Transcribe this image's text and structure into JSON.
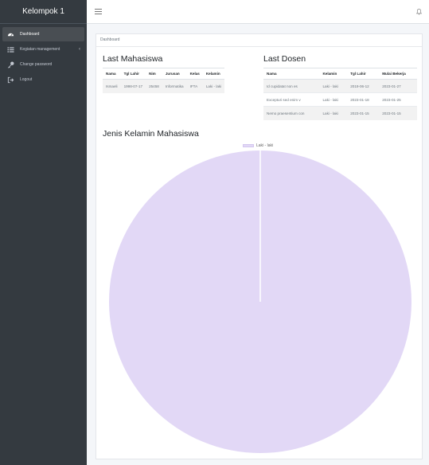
{
  "sidebar": {
    "brand": "Kelompok 1",
    "items": [
      {
        "label": "Dashboard",
        "icon": "dashboard-icon",
        "active": true
      },
      {
        "label": "Kegiatan management",
        "icon": "list-icon",
        "has_submenu": true
      },
      {
        "label": "Change password",
        "icon": "key-icon"
      },
      {
        "label": "Logout",
        "icon": "sign-out-icon"
      }
    ]
  },
  "breadcrumb": "Dashboard",
  "mahasiswa": {
    "title": "Last Mahasiswa",
    "headers": [
      "Nama",
      "Tgl Lahir",
      "Nim",
      "Jurusan",
      "Kelas",
      "Kelamin"
    ],
    "rows": [
      [
        "Ismaeli",
        "1998-07-17",
        "25458",
        "Informatika",
        "IFTA",
        "Laki - laki"
      ]
    ]
  },
  "dosen": {
    "title": "Last Dosen",
    "headers": [
      "Nama",
      "Kelamin",
      "Tgl Lahir",
      "Mulai Bekerja"
    ],
    "rows": [
      [
        "Id cupidatat non es",
        "Laki - laki",
        "2019-06-12",
        "2023-01-27"
      ],
      [
        "Excepturi sed enim v",
        "Laki - laki",
        "2023-01-18",
        "2023-01-25"
      ],
      [
        "Nemo praesentium con",
        "Laki - laki",
        "2023-01-15",
        "2023-01-15"
      ]
    ]
  },
  "chart": {
    "title": "Jenis Kelamin Mahasiswa",
    "legend": "Laki - laki"
  },
  "chart_data": {
    "type": "pie",
    "categories": [
      "Laki - laki"
    ],
    "values": [
      1
    ],
    "colors": [
      "#e2d8f6"
    ]
  }
}
